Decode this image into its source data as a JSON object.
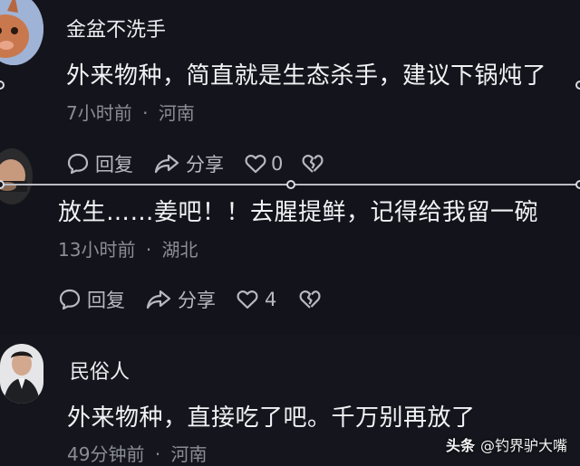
{
  "comments": [
    {
      "username": "金盆不洗手",
      "text": "外来物种，简直就是生态杀手，建议下锅炖了",
      "time": "7小时前",
      "separator": "·",
      "location": "河南",
      "reply_label": "回复",
      "share_label": "分享",
      "like_count": "0"
    },
    {
      "username": "",
      "text": "放生……姜吧！！去腥提鲜，记得给我留一碗",
      "time": "13小时前",
      "separator": "·",
      "location": "湖北",
      "reply_label": "回复",
      "share_label": "分享",
      "like_count": "4"
    },
    {
      "username": "民俗人",
      "text": "外来物种，直接吃了吧。千万别再放了",
      "time": "49分钟前",
      "separator": "·",
      "location": "河南",
      "reply_label": "",
      "share_label": "",
      "like_count": ""
    }
  ],
  "watermark": {
    "brand": "头条",
    "handle": "@钓界驴大嘴"
  },
  "colors": {
    "background": "#14151c",
    "text": "#f2f2f5",
    "meta": "#8b8d96",
    "icon": "#b7b9c1"
  },
  "icons": [
    "comment-icon",
    "share-icon",
    "heart-icon",
    "broken-heart-icon"
  ]
}
